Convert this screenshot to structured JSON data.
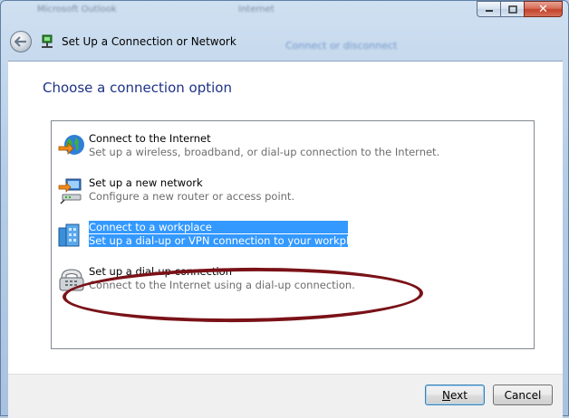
{
  "window": {
    "ghost_tab_1": "Microsoft Outlook",
    "ghost_tab_2": "Internet",
    "ghost_link": "Connect or disconnect",
    "title": "Set Up a Connection or Network"
  },
  "heading": "Choose a connection option",
  "options": [
    {
      "title": "Connect to the Internet",
      "desc": "Set up a wireless, broadband, or dial-up connection to the Internet.",
      "icon": "globe-internet-icon"
    },
    {
      "title": "Set up a new network",
      "desc": "Configure a new router or access point.",
      "icon": "network-computer-icon"
    },
    {
      "title": "Connect to a workplace",
      "desc": "Set up a dial-up or VPN connection to your workplace.",
      "icon": "workplace-building-icon",
      "selected": true
    },
    {
      "title": "Set up a dial-up connection",
      "desc": "Connect to the Internet using a dial-up connection.",
      "icon": "telephone-modem-icon"
    }
  ],
  "buttons": {
    "next_access": "N",
    "next_rest": "ext",
    "cancel": "Cancel"
  },
  "colors": {
    "selection": "#3399ff",
    "annotation": "#7a1218",
    "heading": "#1e3287"
  }
}
